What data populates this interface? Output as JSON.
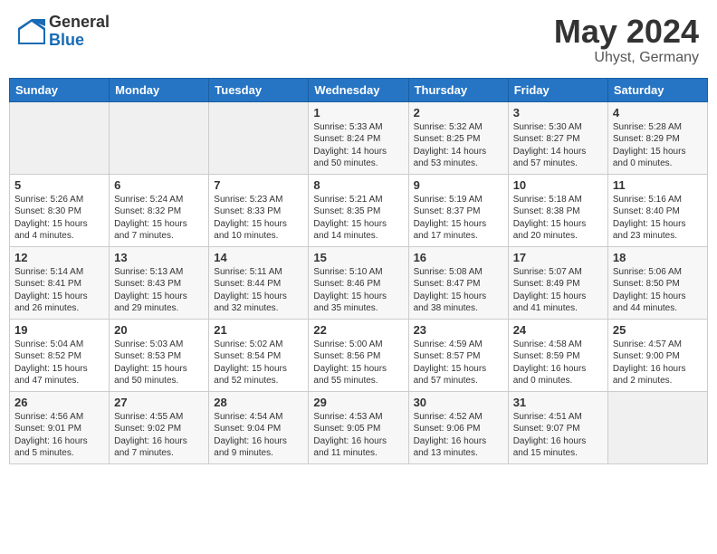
{
  "header": {
    "logo_general": "General",
    "logo_blue": "Blue",
    "month": "May 2024",
    "location": "Uhyst, Germany"
  },
  "weekdays": [
    "Sunday",
    "Monday",
    "Tuesday",
    "Wednesday",
    "Thursday",
    "Friday",
    "Saturday"
  ],
  "weeks": [
    [
      {
        "day": "",
        "info": ""
      },
      {
        "day": "",
        "info": ""
      },
      {
        "day": "",
        "info": ""
      },
      {
        "day": "1",
        "info": "Sunrise: 5:33 AM\nSunset: 8:24 PM\nDaylight: 14 hours\nand 50 minutes."
      },
      {
        "day": "2",
        "info": "Sunrise: 5:32 AM\nSunset: 8:25 PM\nDaylight: 14 hours\nand 53 minutes."
      },
      {
        "day": "3",
        "info": "Sunrise: 5:30 AM\nSunset: 8:27 PM\nDaylight: 14 hours\nand 57 minutes."
      },
      {
        "day": "4",
        "info": "Sunrise: 5:28 AM\nSunset: 8:29 PM\nDaylight: 15 hours\nand 0 minutes."
      }
    ],
    [
      {
        "day": "5",
        "info": "Sunrise: 5:26 AM\nSunset: 8:30 PM\nDaylight: 15 hours\nand 4 minutes."
      },
      {
        "day": "6",
        "info": "Sunrise: 5:24 AM\nSunset: 8:32 PM\nDaylight: 15 hours\nand 7 minutes."
      },
      {
        "day": "7",
        "info": "Sunrise: 5:23 AM\nSunset: 8:33 PM\nDaylight: 15 hours\nand 10 minutes."
      },
      {
        "day": "8",
        "info": "Sunrise: 5:21 AM\nSunset: 8:35 PM\nDaylight: 15 hours\nand 14 minutes."
      },
      {
        "day": "9",
        "info": "Sunrise: 5:19 AM\nSunset: 8:37 PM\nDaylight: 15 hours\nand 17 minutes."
      },
      {
        "day": "10",
        "info": "Sunrise: 5:18 AM\nSunset: 8:38 PM\nDaylight: 15 hours\nand 20 minutes."
      },
      {
        "day": "11",
        "info": "Sunrise: 5:16 AM\nSunset: 8:40 PM\nDaylight: 15 hours\nand 23 minutes."
      }
    ],
    [
      {
        "day": "12",
        "info": "Sunrise: 5:14 AM\nSunset: 8:41 PM\nDaylight: 15 hours\nand 26 minutes."
      },
      {
        "day": "13",
        "info": "Sunrise: 5:13 AM\nSunset: 8:43 PM\nDaylight: 15 hours\nand 29 minutes."
      },
      {
        "day": "14",
        "info": "Sunrise: 5:11 AM\nSunset: 8:44 PM\nDaylight: 15 hours\nand 32 minutes."
      },
      {
        "day": "15",
        "info": "Sunrise: 5:10 AM\nSunset: 8:46 PM\nDaylight: 15 hours\nand 35 minutes."
      },
      {
        "day": "16",
        "info": "Sunrise: 5:08 AM\nSunset: 8:47 PM\nDaylight: 15 hours\nand 38 minutes."
      },
      {
        "day": "17",
        "info": "Sunrise: 5:07 AM\nSunset: 8:49 PM\nDaylight: 15 hours\nand 41 minutes."
      },
      {
        "day": "18",
        "info": "Sunrise: 5:06 AM\nSunset: 8:50 PM\nDaylight: 15 hours\nand 44 minutes."
      }
    ],
    [
      {
        "day": "19",
        "info": "Sunrise: 5:04 AM\nSunset: 8:52 PM\nDaylight: 15 hours\nand 47 minutes."
      },
      {
        "day": "20",
        "info": "Sunrise: 5:03 AM\nSunset: 8:53 PM\nDaylight: 15 hours\nand 50 minutes."
      },
      {
        "day": "21",
        "info": "Sunrise: 5:02 AM\nSunset: 8:54 PM\nDaylight: 15 hours\nand 52 minutes."
      },
      {
        "day": "22",
        "info": "Sunrise: 5:00 AM\nSunset: 8:56 PM\nDaylight: 15 hours\nand 55 minutes."
      },
      {
        "day": "23",
        "info": "Sunrise: 4:59 AM\nSunset: 8:57 PM\nDaylight: 15 hours\nand 57 minutes."
      },
      {
        "day": "24",
        "info": "Sunrise: 4:58 AM\nSunset: 8:59 PM\nDaylight: 16 hours\nand 0 minutes."
      },
      {
        "day": "25",
        "info": "Sunrise: 4:57 AM\nSunset: 9:00 PM\nDaylight: 16 hours\nand 2 minutes."
      }
    ],
    [
      {
        "day": "26",
        "info": "Sunrise: 4:56 AM\nSunset: 9:01 PM\nDaylight: 16 hours\nand 5 minutes."
      },
      {
        "day": "27",
        "info": "Sunrise: 4:55 AM\nSunset: 9:02 PM\nDaylight: 16 hours\nand 7 minutes."
      },
      {
        "day": "28",
        "info": "Sunrise: 4:54 AM\nSunset: 9:04 PM\nDaylight: 16 hours\nand 9 minutes."
      },
      {
        "day": "29",
        "info": "Sunrise: 4:53 AM\nSunset: 9:05 PM\nDaylight: 16 hours\nand 11 minutes."
      },
      {
        "day": "30",
        "info": "Sunrise: 4:52 AM\nSunset: 9:06 PM\nDaylight: 16 hours\nand 13 minutes."
      },
      {
        "day": "31",
        "info": "Sunrise: 4:51 AM\nSunset: 9:07 PM\nDaylight: 16 hours\nand 15 minutes."
      },
      {
        "day": "",
        "info": ""
      }
    ]
  ]
}
